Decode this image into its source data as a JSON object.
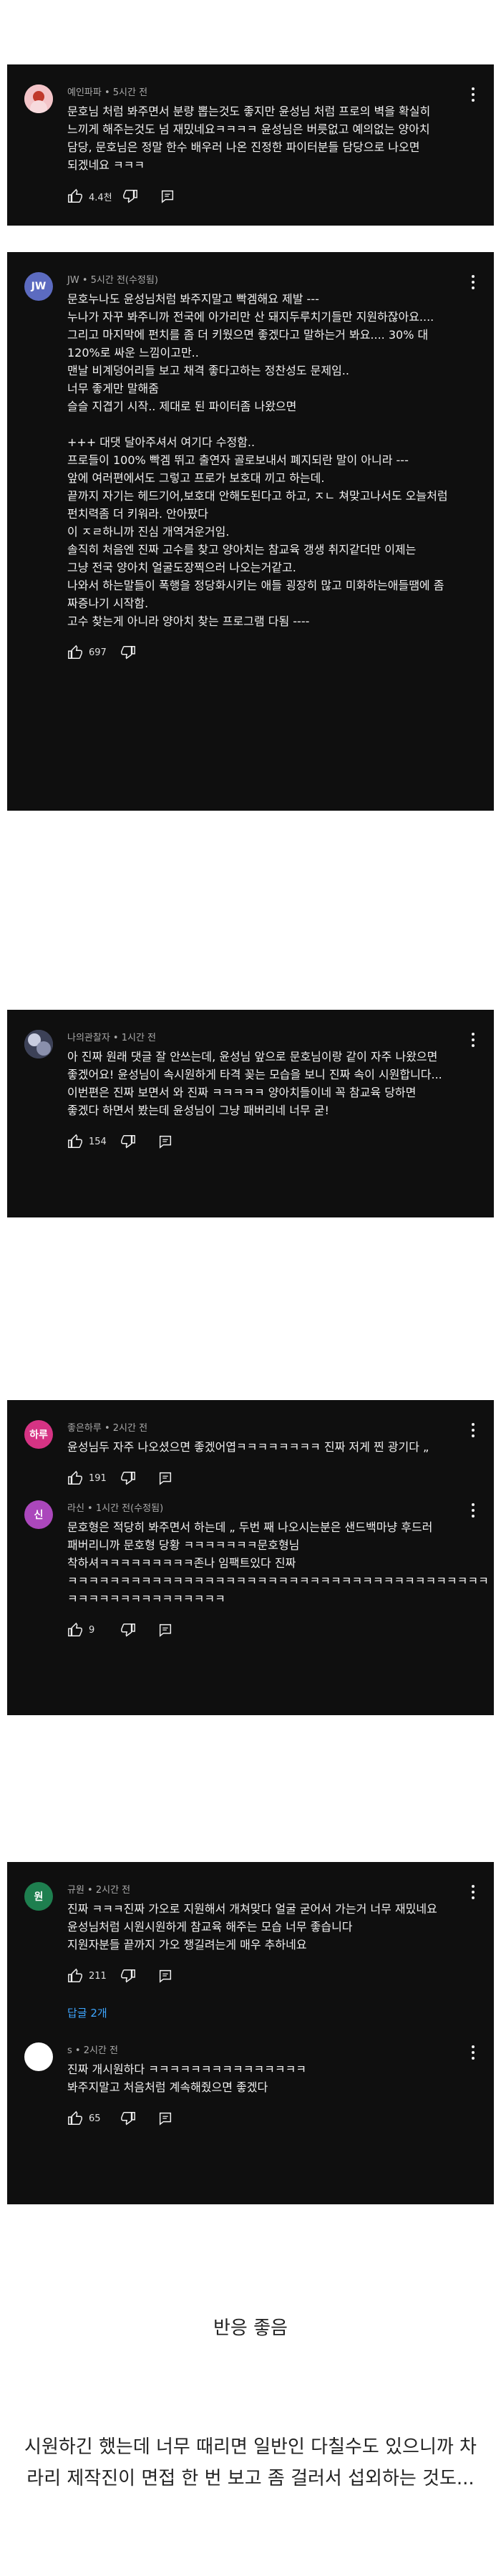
{
  "cards": [
    {
      "comments": [
        {
          "author": "예인파파 • 5시간 전",
          "avatar_color": "#f3c4c8",
          "avatar_text": "",
          "text": "문호님 처럼 봐주면서 분량 뽑는것도 좋지만 윤성님 처럼 프로의 벽을 확실히 느끼게 해주는것도 넘 재밌네요ㅋㅋㅋㅋ 윤성님은 버릇없고 예의없는 양아치 담당, 문호님은 정말 한수 배우러 나온 진정한 파이터분들 담당으로 나오면 되겠네요 ㅋㅋㅋ",
          "likes": "4.4천"
        }
      ]
    },
    {
      "comments": [
        {
          "author": "JW • 5시간 전(수정됨)",
          "avatar_color": "#5c6bc0",
          "avatar_text": "JW",
          "text": "문호누나도 윤성님처럼 봐주지말고 빡겜해요 제발 ---\n누나가 자꾸 봐주니까 전국에 아가리만 산 돼지두루치기들만 지원하잖아요....\n그리고 마지막에 펀치를 좀 더 키웠으면 좋겠다고 말하는거 봐요.... 30% 대 120%로 싸운 느낌이고만..\n맨날 비계덩어리들 보고 채격 좋다고하는 정찬성도 문제임..\n너무 좋게만 말해줌\n슬슬 지겹기 시작.. 제대로 된 파이터좀 나왔으면\n\n+++ 대댓 달아주셔서 여기다 수정함..\n프로들이 100% 빡겜 뛰고 출연자 골로보내서 폐지되란 말이 아니라 ---\n앞에 여러편에서도 그렇고 프로가 보호대 끼고 하는데.\n끝까지 자기는 헤드기어,보호대 안해도된다고 하고, ㅈㄴ 쳐맞고나서도 오늘처럼 펀치력좀 더 키워라. 안아팠다\n이 ㅈㄹ하니까 진심 개역겨운거임.\n솔직히 처음엔 진짜 고수를 찾고 양아치는 참교육 갱생 취지같더만 이제는\n그냥 전국 양아치 얼굴도장찍으러 나오는거같고.\n나와서 하는말들이 폭행을 정당화시키는 애들 굉장히 많고 미화하는애들땜에 좀 짜증나기 시작함.\n고수 찾는게 아니라 양아치 찾는 프로그램 다됨 ----",
          "likes": "697"
        }
      ]
    },
    {
      "comments": [
        {
          "author": "나의관찰자 • 1시간 전",
          "avatar_color": "#6a6f87",
          "avatar_text": "",
          "text": "아 진짜 원래 댓글 잘 안쓰는데, 윤성님 앞으로 문호님이랑 같이 자주 나왔으면 좋겠어요! 윤성님이 속시원하게 타격 꽂는 모습을 보니 진짜 속이 시원합니다... 이번편은 진짜 보면서 와 진짜 ㅋㅋㅋㅋㅋ 양아치들이네 꼭 참교육 당하면 좋겠다 하면서 봤는데 윤성님이 그냥 패버리네 너무 굳!",
          "likes": "154"
        }
      ]
    },
    {
      "comments": [
        {
          "author": "좋은하루 • 2시간 전",
          "avatar_color": "#d63384",
          "avatar_text": "하루",
          "text": "윤성님두 자주 나오셨으면 좋겠어엽ㅋㅋㅋㅋㅋㅋㅋㅋ 진짜 저게 찐 광기다 „",
          "likes": "191"
        },
        {
          "author": "라신 • 1시간 전(수정됨)",
          "avatar_color": "#ab47bc",
          "avatar_text": "신",
          "text": "문호형은 적당히 봐주면서 하는데 „ 두번 째 나오시는분은 샌드백마냥 후드러 패버리니까 문호형 당황 ㅋㅋㅋㅋㅋㅋㅋ문호형님 착하셔ㅋㅋㅋㅋㅋㅋㅋㅋㅋ존나 임팩트있다 진짜 ㅋㅋㅋㅋㅋㅋㅋㅋㅋㅋㅋㅋㅋㅋㅋㅋㅋㅋㅋㅋㅋㅋㅋㅋㅋㅋㅋㅋㅋㅋㅋㅋㅋㅋㅋㅋㅋㅋㅋㅋ ㅋㅋㅋㅋㅋㅋㅋㅋㅋㅋㅋㅋㅋㅋㅋ",
          "likes": "9"
        }
      ]
    },
    {
      "comments": [
        {
          "author": "규원 • 2시간 전",
          "avatar_color": "#1e7f4f",
          "avatar_text": "원",
          "text": "진짜 ㅋㅋㅋ진짜 가오로 지원해서 개쳐맞다 얼굴 굳어서 가는거 너무 재밌네요\n윤성님처럼 시원시원하게 참교육 해주는 모습 너무 좋습니다\n지원자분들 끝까지 가오 챙길려는게 매우 추하네요",
          "likes": "211"
        }
      ],
      "replies_label": "답글 2개",
      "reply": {
        "author": "s • 2시간 전",
        "avatar_color": "#ffffff",
        "avatar_text": "",
        "text": "진짜 개시원하다 ㅋㅋㅋㅋㅋㅋㅋㅋㅋㅋㅋㅋㅋㅋㅋ\n봐주지말고 처음처럼 계속해줬으면 좋겠다",
        "likes": "65"
      }
    }
  ],
  "captions": {
    "reaction": "반응 좋음",
    "note": "시원하긴 했는데 너무 때리면 일반인 다칠수도 있으니까 차라리 제작진이 면접 한 번 보고 좀 걸러서 섭외하는 것도..."
  },
  "icons": {
    "like": "thumbs-up-icon",
    "dislike": "thumbs-down-icon",
    "reply": "reply-icon",
    "more": "more-vert-icon"
  }
}
